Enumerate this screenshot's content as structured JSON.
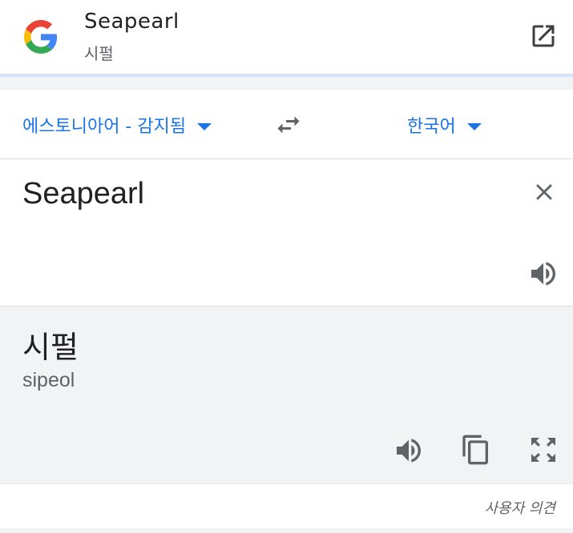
{
  "header": {
    "title": "Seapearl",
    "subtitle": "시펄",
    "logo_icon": "google-g-logo-icon",
    "open_icon": "open-in-new-icon"
  },
  "languages": {
    "source": "에스토니아어 - 감지됨",
    "target": "한국어",
    "swap_icon": "swap-horiz-icon"
  },
  "input": {
    "text": "Seapearl",
    "clear_icon": "close-icon",
    "speaker_icon": "volume-up-icon"
  },
  "result": {
    "text": "시펄",
    "romanization": "sipeol",
    "speaker_icon": "volume-up-icon",
    "copy_icon": "content-copy-icon",
    "fullscreen_icon": "fullscreen-icon"
  },
  "footer": {
    "feedback": "사용자 의견"
  },
  "colors": {
    "accent": "#1a73e8",
    "icon": "#5f6368",
    "result_bg": "#f1f3f4"
  }
}
